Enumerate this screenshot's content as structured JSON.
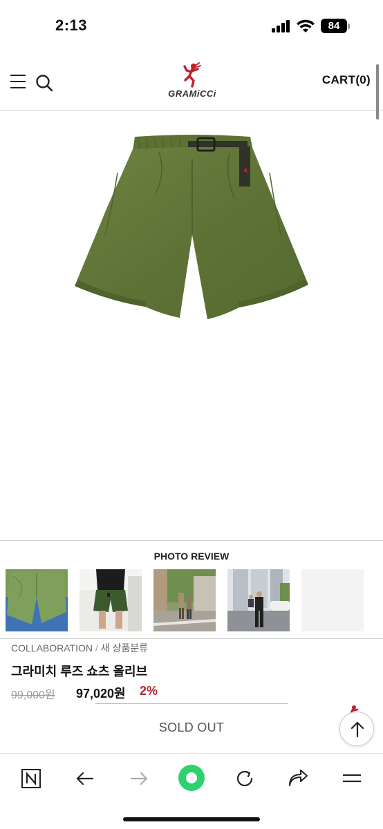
{
  "status_bar": {
    "time": "2:13",
    "battery": "84"
  },
  "header": {
    "logo_text": "GRAMiCCi",
    "cart_label": "CART",
    "cart_count": "(0)"
  },
  "product": {
    "image_icon": "olive-shorts-image",
    "color": "#5f7337"
  },
  "photo_review": {
    "title": "PHOTO REVIEW",
    "thumbnails": [
      "shorts-flatlay-photo",
      "person-wearing-shorts-photo",
      "street-people-photo",
      "apartment-street-photo",
      "blank-photo"
    ]
  },
  "breadcrumb": {
    "category": "COLLABORATION",
    "separator": "/",
    "subcategory": "새 상품분류"
  },
  "product_info": {
    "title": "그라미치 루즈 쇼츠 올리브",
    "original_price": "99,000원",
    "sale_price": "97,020원",
    "discount": "2%",
    "status": "SOLD OUT"
  },
  "toolbar": {
    "icons": [
      "naver-n-icon",
      "back-arrow-icon",
      "forward-arrow-icon",
      "green-home-icon",
      "refresh-icon",
      "share-icon",
      "menu-icon"
    ]
  },
  "colors": {
    "accent_red": "#b0282e",
    "green_button": "#2fd16f"
  }
}
